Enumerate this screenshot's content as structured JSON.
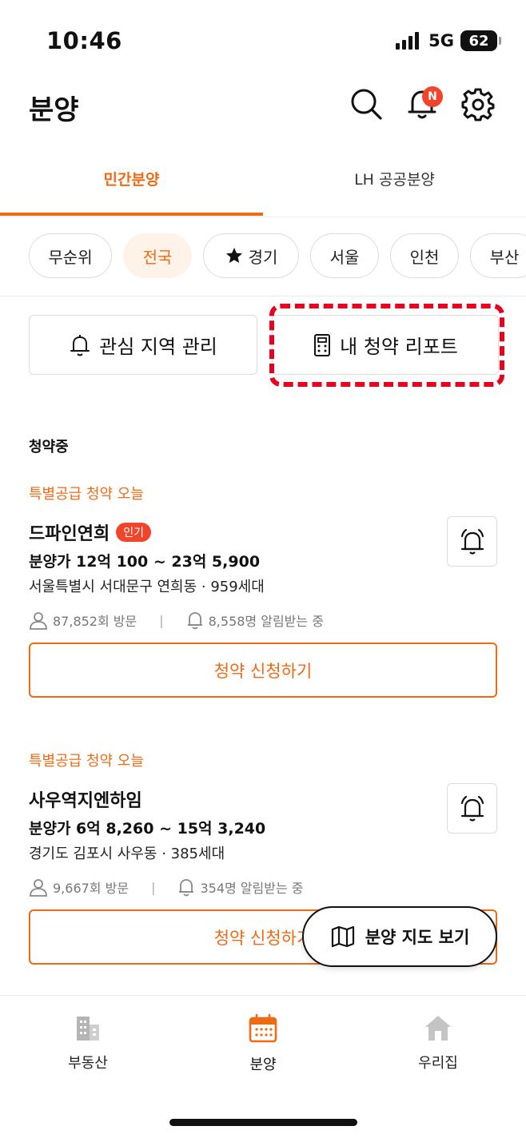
{
  "status": {
    "time": "10:46",
    "network": "5G",
    "battery": "62"
  },
  "header": {
    "title": "분양",
    "notification_badge": "N"
  },
  "tabs": [
    {
      "label": "민간분양",
      "active": true
    },
    {
      "label": "LH 공공분양",
      "active": false
    }
  ],
  "chips": [
    {
      "label": "무순위",
      "active": false
    },
    {
      "label": "전국",
      "active": true
    },
    {
      "label": "경기",
      "active": false,
      "icon": "star-icon"
    },
    {
      "label": "서울",
      "active": false
    },
    {
      "label": "인천",
      "active": false
    },
    {
      "label": "부산",
      "active": false
    }
  ],
  "actions": {
    "interest_region": "관심 지역 관리",
    "my_report": "내 청약 리포트"
  },
  "section_title": "청약중",
  "listings": [
    {
      "tag": "특별공급 청약 오늘",
      "name": "드파인연희",
      "badge": "인기",
      "price": "분양가 12억 100 ~ 23억 5,900",
      "address": "서울특별시 서대문구 연희동 · 959세대",
      "visits": "87,852회 방문",
      "alerts": "8,558명 알림받는 중",
      "apply_label": "청약 신청하기"
    },
    {
      "tag": "특별공급 청약 오늘",
      "name": "사우역지엔하임",
      "badge": "",
      "price": "분양가 6억 8,260 ~ 15억 3,240",
      "address": "경기도 김포시 사우동 · 385세대",
      "visits": "9,667회 방문",
      "alerts": "354명 알림받는 중",
      "apply_label": "청약 신청하기"
    }
  ],
  "map_button": "분양 지도 보기",
  "bottom_nav": [
    {
      "label": "부동산",
      "active": false
    },
    {
      "label": "분양",
      "active": true
    },
    {
      "label": "우리집",
      "active": false
    }
  ],
  "colors": {
    "accent": "#ef6a13",
    "badge": "#f2442b",
    "highlight": "#e8001c"
  }
}
